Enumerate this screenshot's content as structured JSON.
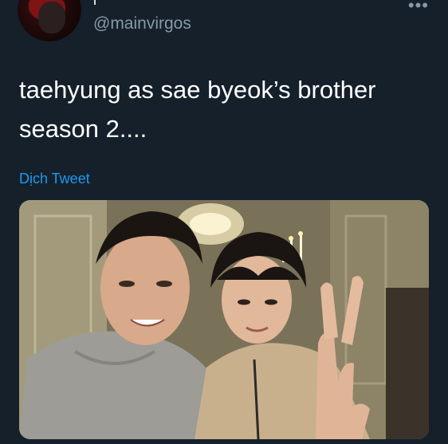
{
  "author": {
    "handle": "@mainvirgos",
    "avatar_icon": "profile-avatar"
  },
  "menu_icon": "more-horizontal-icon",
  "tweet": {
    "text_line1": "taehyung as sae byeok’s brother",
    "text_line2": "season 2....",
    "translate_label": "Dịch Tweet"
  },
  "colors": {
    "background": "#15202b",
    "handle": "#8899a6",
    "link": "#1d9bf0"
  }
}
